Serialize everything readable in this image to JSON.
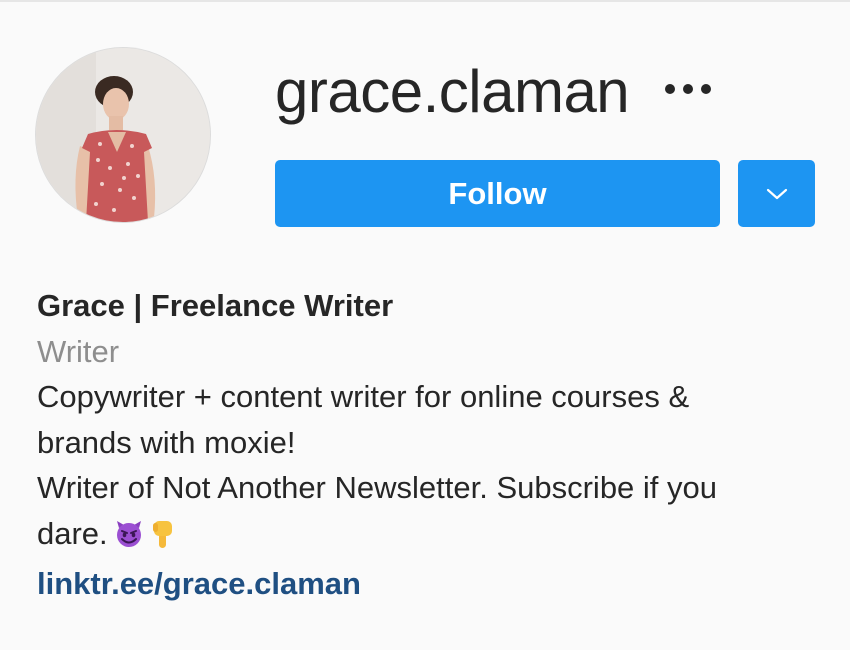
{
  "profile": {
    "username": "grace.claman",
    "more_icon": "more-horizontal-icon",
    "avatar_alt": "profile-photo"
  },
  "actions": {
    "follow_label": "Follow",
    "dropdown_icon": "chevron-down-icon"
  },
  "bio": {
    "full_name": "Grace | Freelance Writer",
    "category": "Writer",
    "lines": [
      "Copywriter + content writer for online courses &",
      "brands with moxie!",
      "Writer of Not Another Newsletter. Subscribe if you",
      "dare."
    ],
    "emojis": [
      "smiling-devil-emoji",
      "pointing-down-emoji"
    ],
    "link": "linktr.ee/grace.claman"
  },
  "colors": {
    "accent": "#1d95f2",
    "link": "#1f4f82",
    "secondary_text": "#8e8e8e",
    "background": "#fafafa"
  }
}
